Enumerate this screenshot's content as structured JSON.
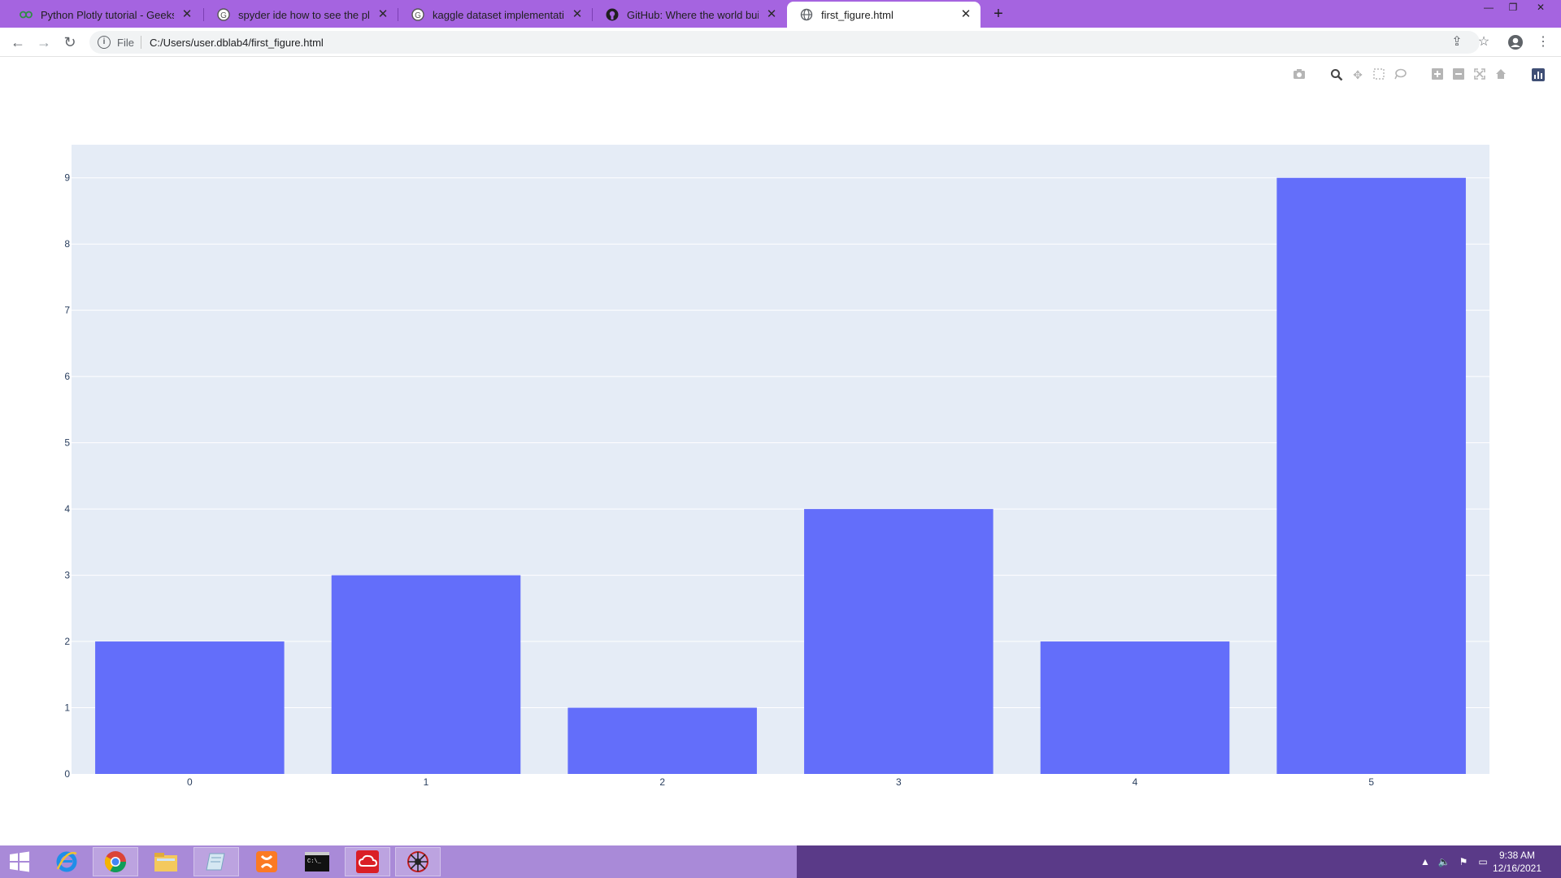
{
  "browser": {
    "tabs": [
      {
        "title": "Python Plotly tutorial - Geeksfor",
        "icon": "geeksforgeeks-icon"
      },
      {
        "title": "spyder ide how to see the plot g",
        "icon": "google-icon"
      },
      {
        "title": "kaggle dataset implementation i",
        "icon": "google-icon"
      },
      {
        "title": "GitHub: Where the world builds s",
        "icon": "github-icon"
      },
      {
        "title": "first_figure.html",
        "icon": "globe-icon",
        "active": true
      }
    ],
    "new_tab": "+",
    "address": {
      "scheme": "File",
      "url": "C:/Users/user.dblab4/first_figure.html"
    }
  },
  "chart_data": {
    "type": "bar",
    "categories": [
      "0",
      "1",
      "2",
      "3",
      "4",
      "5"
    ],
    "values": [
      2,
      3,
      1,
      4,
      2,
      9
    ],
    "ylim": [
      0,
      9.5
    ],
    "yticks": [
      0,
      1,
      2,
      3,
      4,
      5,
      6,
      7,
      8,
      9
    ],
    "grid": true,
    "colors": {
      "bar": "#636efa",
      "plot_bg": "#e5ecf6",
      "grid": "#ffffff"
    }
  },
  "taskbar": {
    "clock": {
      "time": "9:38 AM",
      "date": "12/16/2021"
    },
    "apps": [
      "windows-start-icon",
      "internet-explorer-icon",
      "chrome-icon",
      "file-explorer-icon",
      "notepad-icon",
      "xampp-icon",
      "command-prompt-icon",
      "creative-cloud-icon",
      "spider-app-icon"
    ]
  }
}
